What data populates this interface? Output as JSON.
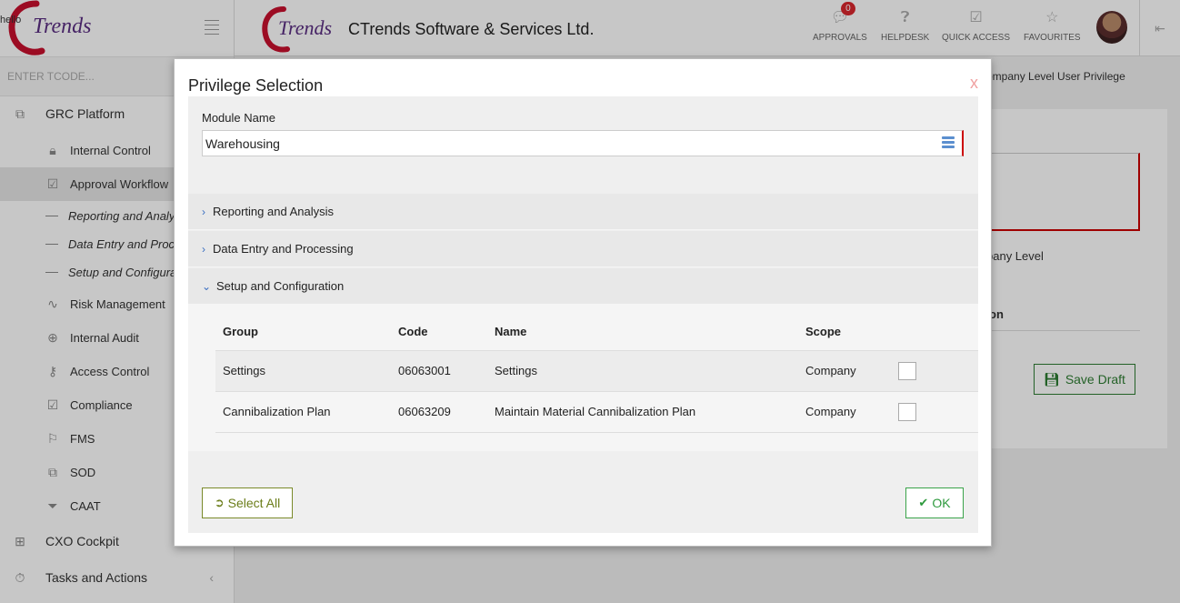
{
  "sidebar": {
    "greeting": "hello",
    "logo_text": "Trends",
    "tcode_placeholder": "ENTER TCODE...",
    "grc_platform": "GRC Platform",
    "internal_control": "Internal Control",
    "approval_workflow": "Approval Workflow",
    "reporting": "Reporting and Analy",
    "data_entry": "Data Entry and Proc",
    "setup": "Setup and Configura",
    "risk_management": "Risk Management",
    "internal_audit": "Internal Audit",
    "access_control": "Access Control",
    "compliance": "Compliance",
    "fms": "FMS",
    "sod": "SOD",
    "caat": "CAAT",
    "cxo_cockpit": "CXO Cockpit",
    "tasks_actions": "Tasks and Actions"
  },
  "header": {
    "logo_text": "Trends",
    "company": "CTrends Software & Services Ltd.",
    "approvals": "APPROVALS",
    "approvals_count": "0",
    "helpdesk": "HELPDESK",
    "quick_access": "QUICK ACCESS",
    "favourites": "FAVOURITES"
  },
  "main": {
    "breadcrumb": "ompany Level User Privilege",
    "level_label": "pany Level",
    "col_partial": "on",
    "save_draft": "Save Draft"
  },
  "modal": {
    "title": "Privilege Selection",
    "close": "x",
    "module_label": "Module Name",
    "module_value": "Warehousing",
    "sections": {
      "reporting": "Reporting and Analysis",
      "data_entry": "Data Entry and Processing",
      "setup": "Setup and Configuration"
    },
    "table": {
      "headers": [
        "Group",
        "Code",
        "Name",
        "Scope"
      ],
      "rows": [
        {
          "group": "Settings",
          "code": "06063001",
          "name": "Settings",
          "scope": "Company"
        },
        {
          "group": "Cannibalization Plan",
          "code": "06063209",
          "name": "Maintain Material Cannibalization Plan",
          "scope": "Company"
        }
      ]
    },
    "select_all": "Select All",
    "ok": "OK"
  },
  "colors": {
    "accent_red": "#c00000",
    "ok_green": "#2e9a3e",
    "select_olive": "#6b7d1a",
    "chevron_blue": "#3b6fc2"
  }
}
